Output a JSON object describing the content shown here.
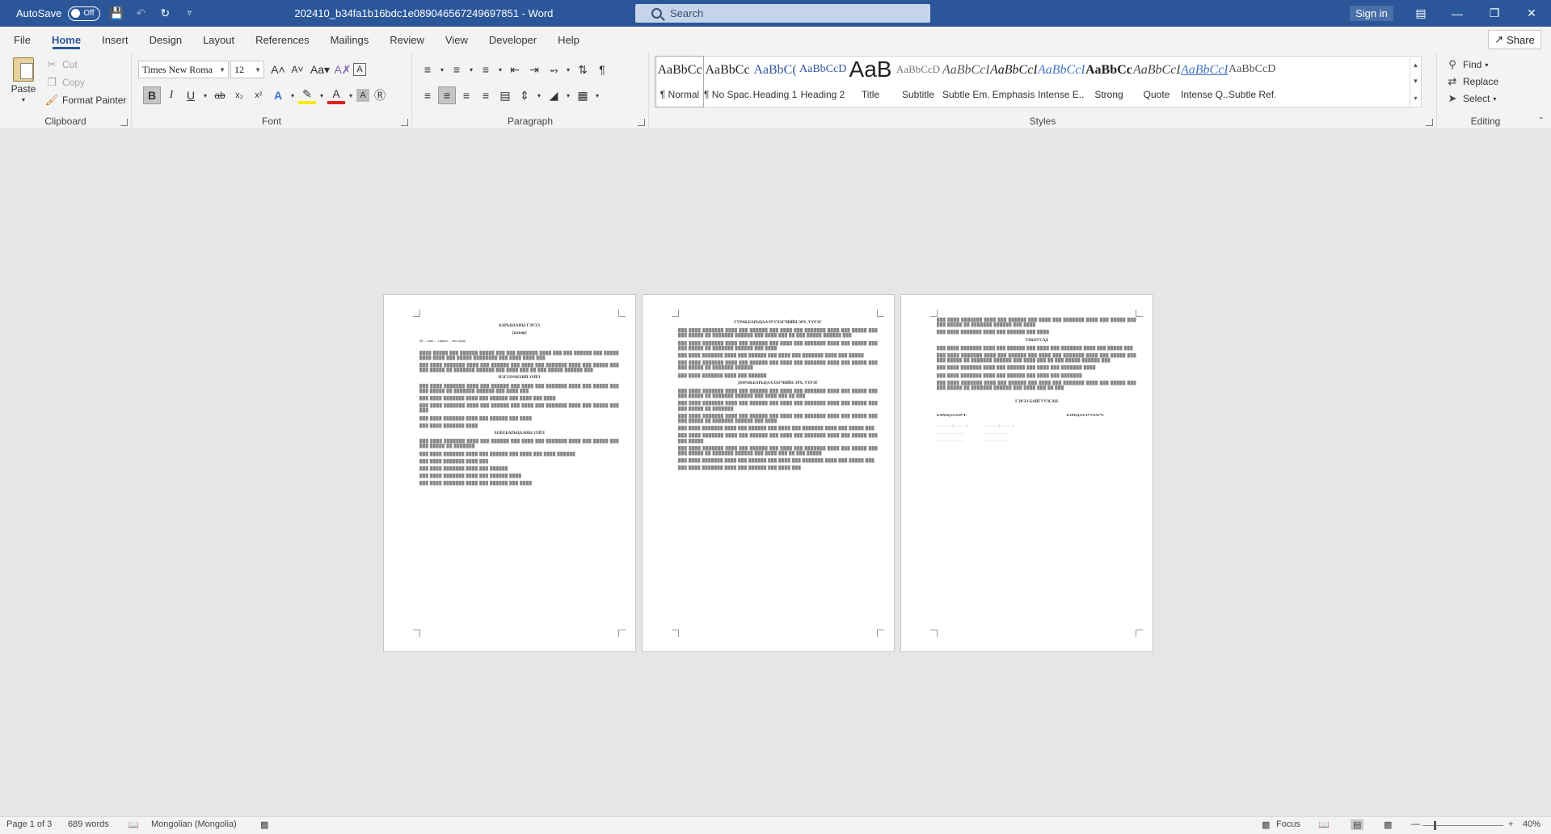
{
  "titlebar": {
    "autosave_label": "AutoSave",
    "autosave_state": "Off",
    "document_title": "202410_b34fa1b16bdc1e089046567249697851  -  Word",
    "search_placeholder": "Search",
    "signin_label": "Sign in"
  },
  "menu": {
    "tabs": [
      "File",
      "Home",
      "Insert",
      "Design",
      "Layout",
      "References",
      "Mailings",
      "Review",
      "View",
      "Developer",
      "Help"
    ],
    "active": "Home",
    "share_label": "Share"
  },
  "clipboard": {
    "paste": "Paste",
    "cut": "Cut",
    "copy": "Copy",
    "format_painter": "Format Painter",
    "group_label": "Clipboard"
  },
  "font": {
    "family": "Times New Roma",
    "size": "12",
    "group_label": "Font"
  },
  "paragraph": {
    "group_label": "Paragraph"
  },
  "styles": {
    "group_label": "Styles",
    "items": [
      {
        "sample": "AaBbCc",
        "name": "¶ Normal"
      },
      {
        "sample": "AaBbCc",
        "name": "¶ No Spac..."
      },
      {
        "sample": "AaBbC(",
        "name": "Heading 1"
      },
      {
        "sample": "AaBbCcD",
        "name": "Heading 2"
      },
      {
        "sample": "AaB",
        "name": "Title"
      },
      {
        "sample": "AaBbCcD",
        "name": "Subtitle"
      },
      {
        "sample": "AaBbCcD",
        "name": "Subtle Em..."
      },
      {
        "sample": "AaBbCcD",
        "name": "Emphasis"
      },
      {
        "sample": "AaBbCcD",
        "name": "Intense E..."
      },
      {
        "sample": "AaBbCcD",
        "name": "Strong"
      },
      {
        "sample": "AaBbCcD",
        "name": "Quote"
      },
      {
        "sample": "AaBbCcD",
        "name": "Intense Q..."
      },
      {
        "sample": "AaBbCcD",
        "name": "Subtle Ref..."
      }
    ]
  },
  "editing": {
    "group_label": "Editing",
    "find": "Find",
    "replace": "Replace",
    "select": "Select"
  },
  "pages": {
    "p1": {
      "title": "БАРЬЦААНЫ ГЭРЭЭ",
      "subtitle": "(загвар)",
      "line1": "20... оны ... сарын ...-ны өдөр",
      "h1": "НЭГ.ЕРӨНХИЙ ЗҮЙЛ",
      "h2": "ХОЁР.БАРЬЦААНЫ ЗҮЙЛ"
    },
    "p2": {
      "h1": "ГУРАВ.БАРЬЦААЛУУЛАГЧИЙН ЭРХ, ҮҮРЭГ",
      "h2": "ДӨРӨВ.БАРЬЦААЛАГЧИЙН ЭРХ, ҮҮРЭГ"
    },
    "p3": {
      "h1": "ТАВ.БУСАД",
      "h2": "ГЭРЭЭ БАЙГУУЛСАН",
      "left_party": "БАРЬЦААЛАГЧ:",
      "right_party": "БАРЬЦААЛУУЛАГЧ:"
    }
  },
  "status": {
    "page": "Page 1 of 3",
    "words": "689 words",
    "language": "Mongolian (Mongolia)",
    "focus": "Focus",
    "zoom": "40%"
  }
}
